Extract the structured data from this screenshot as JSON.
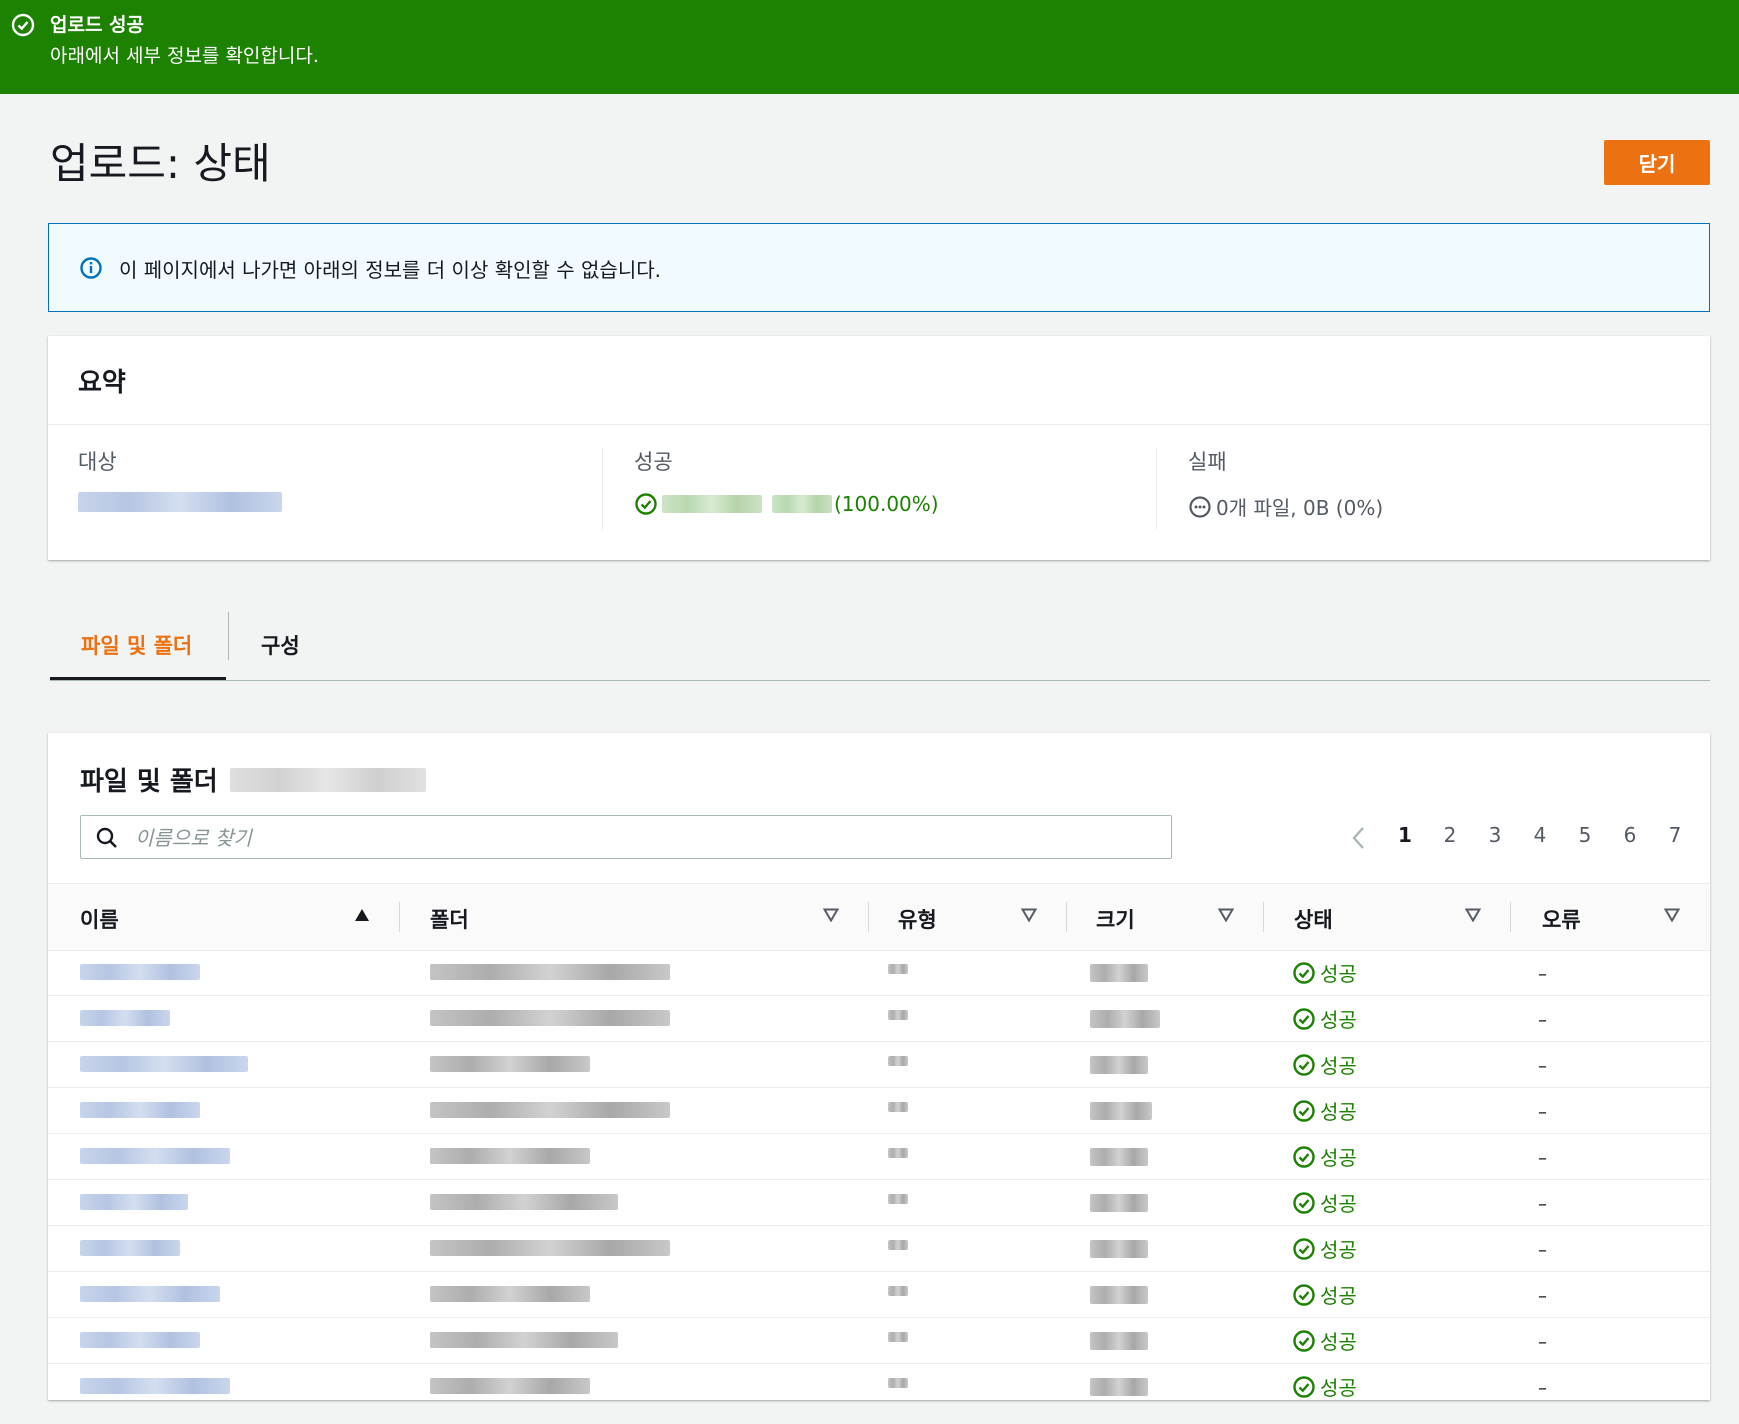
{
  "flash": {
    "title": "업로드 성공",
    "message": "아래에서 세부 정보를 확인합니다.",
    "color": "#1d8102"
  },
  "page": {
    "title": "업로드: 상태",
    "close_label": "닫기",
    "accent": "#ec7211"
  },
  "info": {
    "message": "이 페이지에서 나가면 아래의 정보를 더 이상 확인할 수 없습니다."
  },
  "summary": {
    "title": "요약",
    "target_label": "대상",
    "success_label": "성공",
    "success_percent": "(100.00%)",
    "failure_label": "실패",
    "failure_value": "0개 파일, 0B (0%)"
  },
  "tabs": [
    {
      "label": "파일 및 폴더",
      "active": true
    },
    {
      "label": "구성",
      "active": false
    }
  ],
  "files_panel": {
    "title": "파일 및 폴더",
    "search_placeholder": "이름으로 찾기",
    "pages": [
      "1",
      "2",
      "3",
      "4",
      "5",
      "6",
      "7"
    ],
    "current_page": "1",
    "columns": [
      "이름",
      "폴더",
      "유형",
      "크기",
      "상태",
      "오류"
    ],
    "rows": [
      {
        "status": "성공",
        "error": "–"
      },
      {
        "status": "성공",
        "error": "–"
      },
      {
        "status": "성공",
        "error": "–"
      },
      {
        "status": "성공",
        "error": "–"
      },
      {
        "status": "성공",
        "error": "–"
      },
      {
        "status": "성공",
        "error": "–"
      },
      {
        "status": "성공",
        "error": "–"
      },
      {
        "status": "성공",
        "error": "–"
      },
      {
        "status": "성공",
        "error": "–"
      },
      {
        "status": "성공",
        "error": "–"
      }
    ]
  }
}
